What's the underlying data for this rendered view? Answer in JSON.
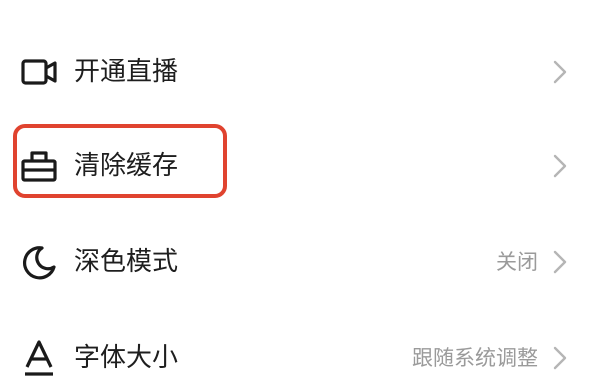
{
  "menu": {
    "items": [
      {
        "label": "开通直播",
        "value": "",
        "icon": "video-camera-icon"
      },
      {
        "label": "清除缓存",
        "value": "",
        "icon": "broom-bag-icon"
      },
      {
        "label": "深色模式",
        "value": "关闭",
        "icon": "moon-icon"
      },
      {
        "label": "字体大小",
        "value": "跟随系统调整",
        "icon": "font-size-icon"
      }
    ]
  },
  "colors": {
    "highlight": "#e0432f",
    "label": "#1e1e1e",
    "value": "#9a9a9a",
    "chevron": "#b5b5b5"
  }
}
